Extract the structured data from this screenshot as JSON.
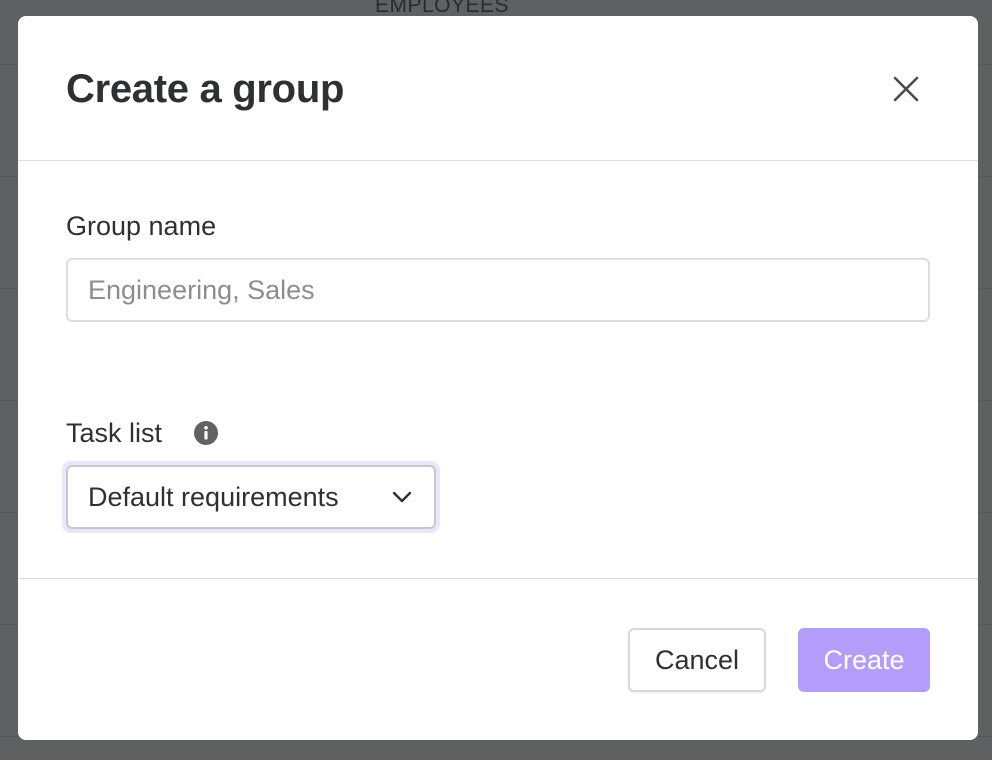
{
  "background": {
    "column_header": "EMPLOYEES"
  },
  "modal": {
    "title": "Create a group",
    "close_icon": "close-icon",
    "group_name": {
      "label": "Group name",
      "value": "",
      "placeholder": "Engineering, Sales"
    },
    "task_list": {
      "label": "Task list",
      "info_icon": "info-icon",
      "selected": "Default requirements",
      "chevron_icon": "chevron-down-icon"
    },
    "footer": {
      "cancel_label": "Cancel",
      "create_label": "Create"
    }
  },
  "colors": {
    "overlay": "#5e6062",
    "primary_disabled": "#b39cfa",
    "focus_ring": "#ebe6ff",
    "text": "#2f3033"
  }
}
